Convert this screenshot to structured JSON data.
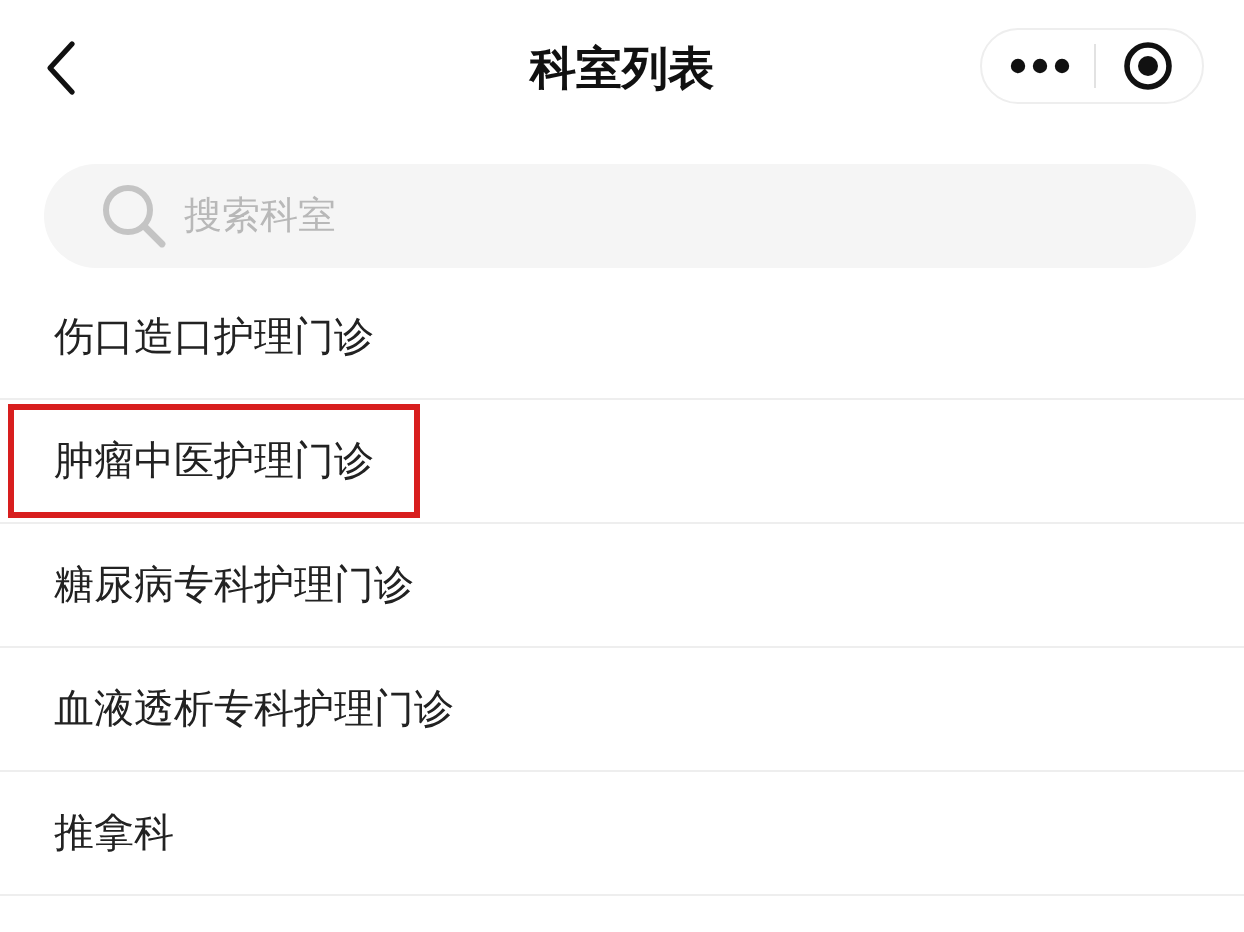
{
  "header": {
    "title": "科室列表"
  },
  "search": {
    "placeholder": "搜索科室"
  },
  "departments": [
    {
      "name": "伤口造口护理门诊",
      "highlighted": false
    },
    {
      "name": "肿瘤中医护理门诊",
      "highlighted": true
    },
    {
      "name": "糖尿病专科护理门诊",
      "highlighted": false
    },
    {
      "name": "血液透析专科护理门诊",
      "highlighted": false
    },
    {
      "name": "推拿科",
      "highlighted": false
    }
  ]
}
